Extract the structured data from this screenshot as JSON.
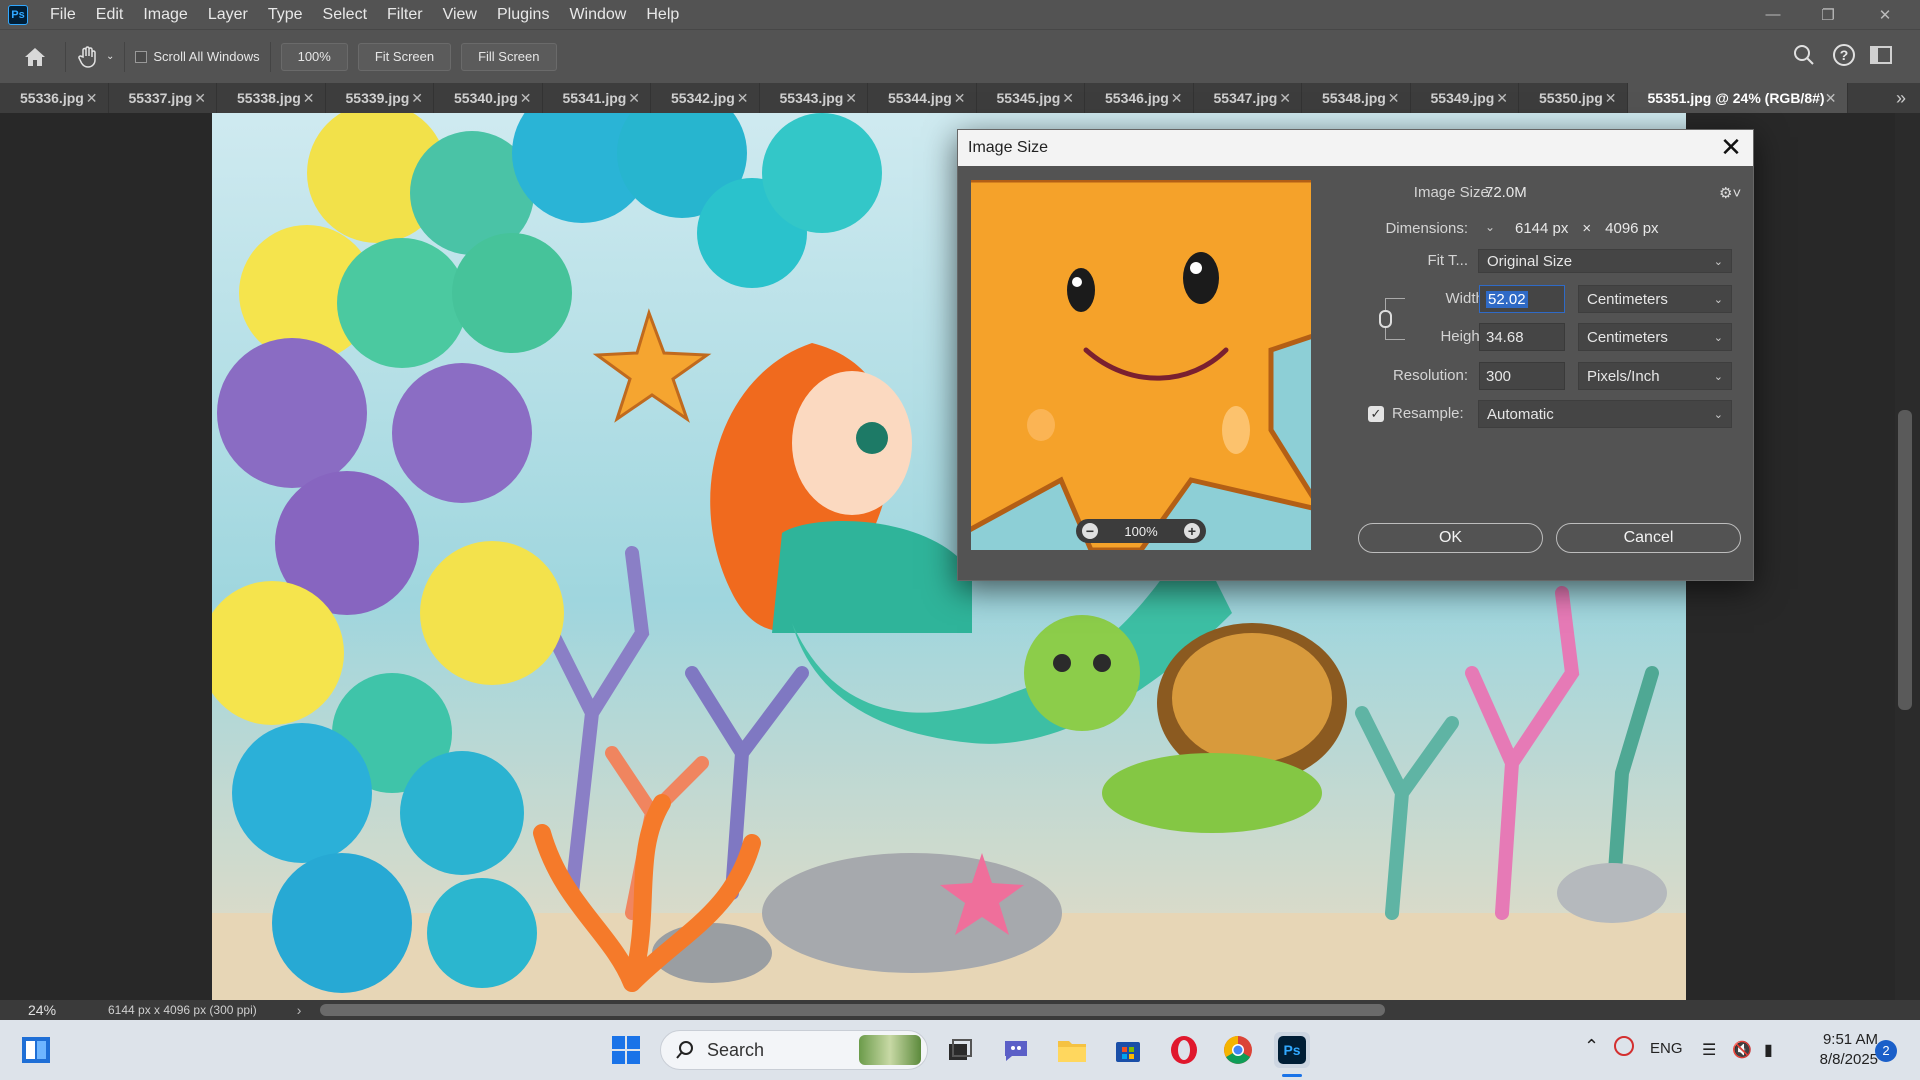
{
  "menubar": {
    "app_icon": "Ps",
    "items": [
      "File",
      "Edit",
      "Image",
      "Layer",
      "Type",
      "Select",
      "Filter",
      "View",
      "Plugins",
      "Window",
      "Help"
    ]
  },
  "options": {
    "scroll_all_windows": "Scroll All Windows",
    "zoom_100": "100%",
    "fit_screen": "Fit Screen",
    "fill_screen": "Fill Screen"
  },
  "tabs": {
    "items": [
      "55336.jpg",
      "55337.jpg",
      "55338.jpg",
      "55339.jpg",
      "55340.jpg",
      "55341.jpg",
      "55342.jpg",
      "55343.jpg",
      "55344.jpg",
      "55345.jpg",
      "55346.jpg",
      "55347.jpg",
      "55348.jpg",
      "55349.jpg",
      "55350.jpg"
    ],
    "active": "55351.jpg @ 24% (RGB/8#)",
    "more": "»"
  },
  "status": {
    "zoom": "24%",
    "doc_info": "6144 px x 4096 px (300 ppi)",
    "arrow": "›"
  },
  "dialog": {
    "title": "Image Size",
    "image_size_label": "Image Size:",
    "image_size_value": "72.0M",
    "dimensions_label": "Dimensions:",
    "dim_w": "6144 px",
    "dim_x": "×",
    "dim_h": "4096 px",
    "fit_to_label": "Fit T...",
    "fit_to_value": "Original Size",
    "width_label": "Width:",
    "width_value": "52.02",
    "width_unit": "Centimeters",
    "height_label": "Height:",
    "height_value": "34.68",
    "height_unit": "Centimeters",
    "resolution_label": "Resolution:",
    "resolution_value": "300",
    "resolution_unit": "Pixels/Inch",
    "resample_label": "Resample:",
    "resample_value": "Automatic",
    "resample_checked": true,
    "preview_zoom": "100%",
    "ok": "OK",
    "cancel": "Cancel"
  },
  "taskbar": {
    "search_placeholder": "Search",
    "lang": "ENG",
    "time": "9:51 AM",
    "date": "8/8/2025",
    "notification_count": "2"
  }
}
